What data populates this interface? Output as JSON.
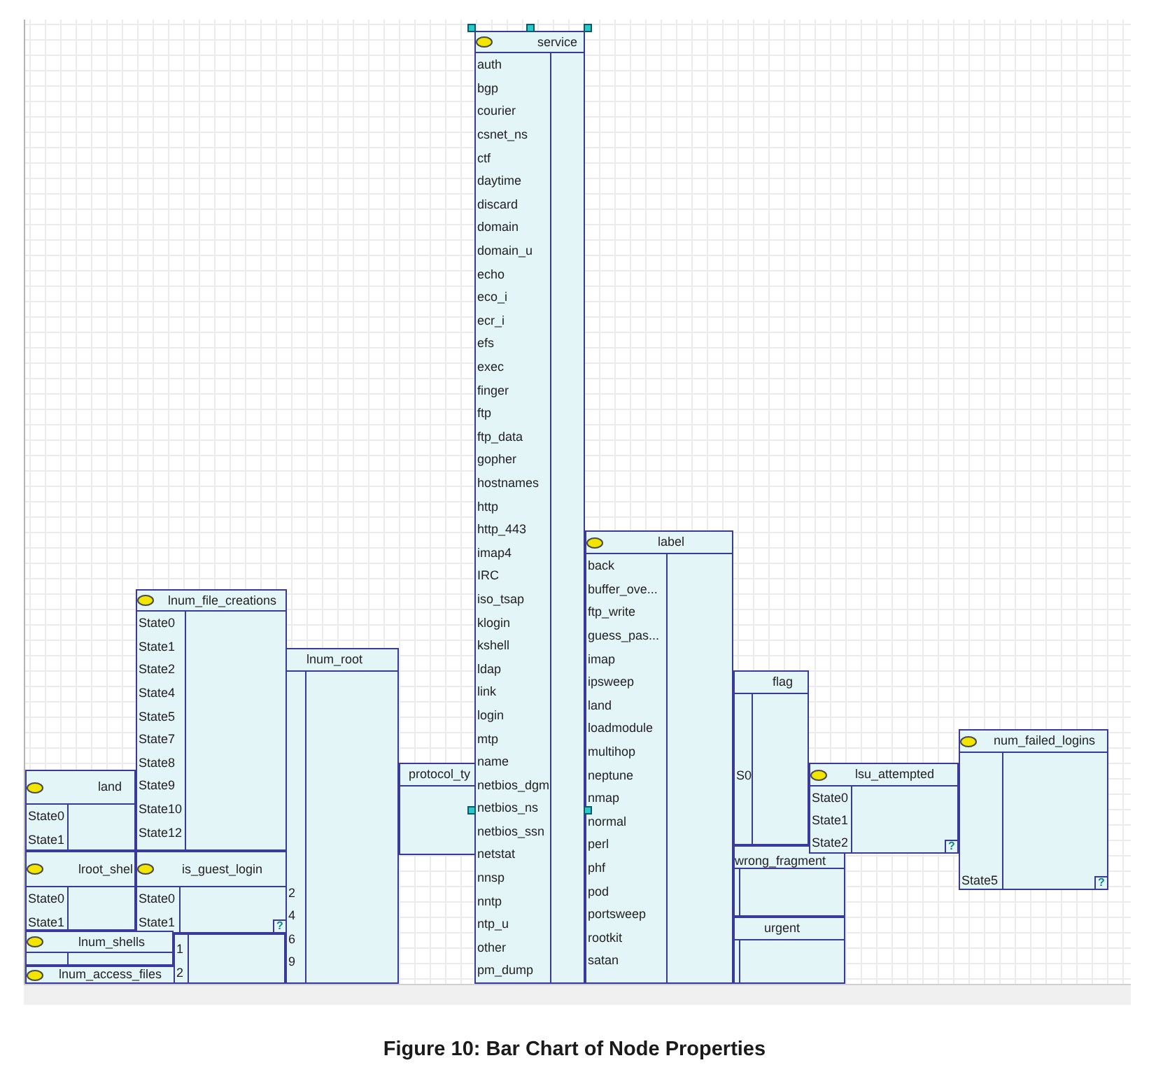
{
  "canvas": {
    "nodes": [
      {
        "title": "land",
        "selected": false,
        "states": [
          "State0",
          "State1"
        ]
      },
      {
        "title": "lnum_file_creations",
        "selected": false,
        "states": [
          "State0",
          "State1",
          "State2",
          "State4",
          "State5",
          "State7",
          "State8",
          "State9",
          "State10",
          "State12"
        ]
      },
      {
        "title": "lnum_root",
        "selected": false,
        "states": [
          "2",
          "4",
          "6",
          "9"
        ]
      },
      {
        "title": "protocol_ty",
        "selected": false
      },
      {
        "title": "lroot_shel",
        "selected": false,
        "states": [
          "State0",
          "State1"
        ]
      },
      {
        "title": "is_guest_login",
        "selected": false,
        "states": [
          "State0",
          "State1"
        ],
        "badge": "?"
      },
      {
        "title": "lnum_shells",
        "selected": false
      },
      {
        "title": "lnum_access_files",
        "selected": false
      },
      {
        "selected": false,
        "states": [
          "1",
          "2"
        ]
      },
      {
        "title": "service",
        "selected": true,
        "states": [
          "auth",
          "bgp",
          "courier",
          "csnet_ns",
          "ctf",
          "daytime",
          "discard",
          "domain",
          "domain_u",
          "echo",
          "eco_i",
          "ecr_i",
          "efs",
          "exec",
          "finger",
          "ftp",
          "ftp_data",
          "gopher",
          "hostnames",
          "http",
          "http_443",
          "imap4",
          "IRC",
          "iso_tsap",
          "klogin",
          "kshell",
          "ldap",
          "link",
          "login",
          "mtp",
          "name",
          "netbios_dgm",
          "netbios_ns",
          "netbios_ssn",
          "netstat",
          "nnsp",
          "nntp",
          "ntp_u",
          "other",
          "pm_dump"
        ]
      },
      {
        "title": "label",
        "selected": false,
        "states": [
          "back",
          "buffer_ove...",
          "ftp_write",
          "guess_pas...",
          "imap",
          "ipsweep",
          "land",
          "loadmodule",
          "multihop",
          "neptune",
          "nmap",
          "normal",
          "perl",
          "phf",
          "pod",
          "portsweep",
          "rootkit",
          "satan"
        ]
      },
      {
        "title": "flag",
        "selected": false,
        "states": [
          "S0"
        ]
      },
      {
        "title": "wrong_fragment",
        "selected": false
      },
      {
        "title": "lsu_attempted",
        "selected": false,
        "states": [
          "State0",
          "State1",
          "State2"
        ],
        "badge": "?"
      },
      {
        "title": "num_failed_logins",
        "selected": false,
        "states": [
          "State5"
        ],
        "badge": "?"
      },
      {
        "title": "urgent",
        "selected": false
      }
    ]
  },
  "caption": "Figure 10: Bar Chart of Node Properties"
}
